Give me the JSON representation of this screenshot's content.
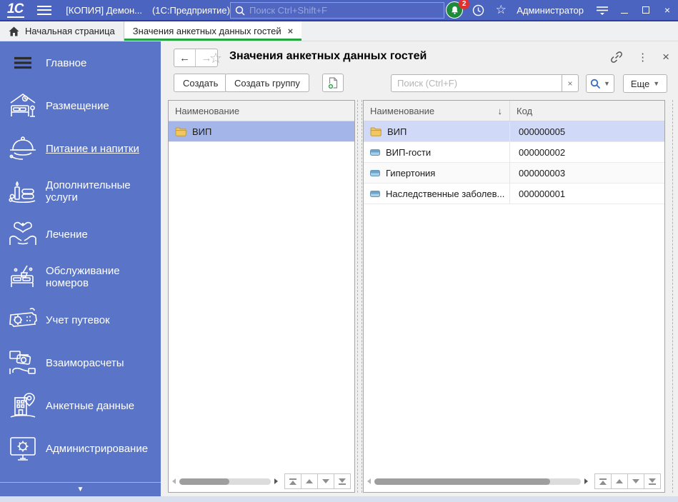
{
  "titlebar": {
    "app_title": "[КОПИЯ] Демон...",
    "app_suffix": "(1С:Предприятие)",
    "logo": "1С",
    "search_placeholder": "Поиск Ctrl+Shift+F",
    "notification_count": "2",
    "user": "Администратор"
  },
  "glyphs": {
    "star": "☆",
    "close": "×",
    "tab_close": "×",
    "dots": "⋮",
    "back": "←",
    "forward": "→",
    "caret": "▼",
    "collapse": "▼",
    "sort_down": "↓",
    "clear": "×"
  },
  "tabs": {
    "home": {
      "label": "Начальная страница"
    },
    "active": {
      "label": "Значения анкетных данных гостей"
    }
  },
  "sidebar": {
    "items": [
      {
        "label": "Главное"
      },
      {
        "label": "Размещение"
      },
      {
        "label": "Питание и напитки"
      },
      {
        "label": "Дополнительные услуги"
      },
      {
        "label": "Лечение"
      },
      {
        "label": "Обслуживание номеров"
      },
      {
        "label": "Учет путевок"
      },
      {
        "label": "Взаиморасчеты"
      },
      {
        "label": "Анкетные данные"
      },
      {
        "label": "Администрирование"
      }
    ]
  },
  "content": {
    "title": "Значения анкетных данных гостей",
    "toolbar": {
      "create_label": "Создать",
      "create_group_label": "Создать группу",
      "search_placeholder": "Поиск (Ctrl+F)",
      "more_label": "Еще"
    },
    "left_table": {
      "header": "Наименование",
      "rows": [
        {
          "name": "ВИП"
        }
      ]
    },
    "right_table": {
      "header_name": "Наименование",
      "header_code": "Код",
      "rows": [
        {
          "name": "ВИП",
          "code": "000000005"
        },
        {
          "name": "ВИП-гости",
          "code": "000000002"
        },
        {
          "name": "Гипертония",
          "code": "000000003"
        },
        {
          "name": "Наследственные заболев...",
          "code": "000000001"
        }
      ]
    }
  },
  "colors": {
    "topbar": "#4b64bf",
    "sidebar": "#5a75c8",
    "tab_underline_green": "#27a343",
    "selection_strong": "#a4b5ea",
    "selection_light": "#d0daf8",
    "notification_green": "#1e8a3c",
    "badge_red": "#e03131",
    "magnifier_blue": "#2f6fc0",
    "folder_yellow": "#f3c75f"
  }
}
